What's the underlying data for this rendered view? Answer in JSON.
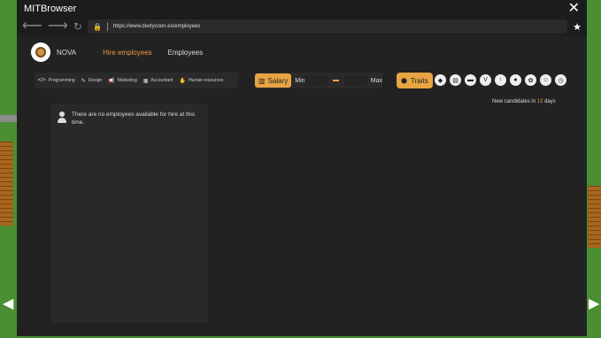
{
  "browser": {
    "title": "MITBrowser",
    "url": "https://www.devtycoon.es/employees",
    "icons": {
      "back": "arrow-left-icon",
      "forward": "arrow-right-icon",
      "reload": "reload-icon",
      "lock": "lock-icon",
      "bookmark": "star-icon",
      "close": "close-icon"
    }
  },
  "header": {
    "company_name": "NOVA",
    "tabs": [
      {
        "label": "Hire employees",
        "active": true
      },
      {
        "label": "Employees",
        "active": false
      }
    ]
  },
  "filters": {
    "categories": [
      {
        "label": "Programming",
        "icon": "code-icon"
      },
      {
        "label": "Design",
        "icon": "brush-icon"
      },
      {
        "label": "Marketing",
        "icon": "megaphone-icon"
      },
      {
        "label": "Accountant",
        "icon": "calculator-icon"
      },
      {
        "label": "Human resources",
        "icon": "handshake-icon"
      }
    ],
    "salary": {
      "label": "Salary",
      "min_label": "Min",
      "max_label": "Max"
    },
    "traits": {
      "label": "Traits",
      "icons": [
        "shield-icon",
        "trash-icon",
        "bread-icon",
        "vest-icon",
        "chart-icon",
        "cookie-icon",
        "brain-icon",
        "face-icon",
        "clock-icon"
      ]
    }
  },
  "candidates": {
    "prefix": "New candidates in",
    "days": "13",
    "suffix": "days"
  },
  "empty_message": "There are no employees available for hire at this time.",
  "colors": {
    "accent": "#e89a3c",
    "button": "#e8a442",
    "background": "#222222",
    "panel": "#292929"
  }
}
